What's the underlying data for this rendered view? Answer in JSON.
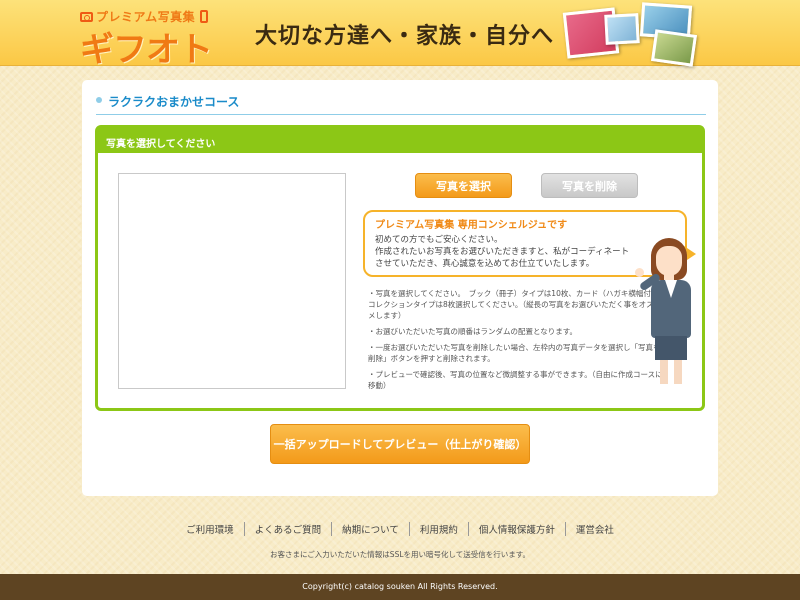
{
  "header": {
    "logo_sub": "プレミアム写真集",
    "logo_main": "ギフオト",
    "tagline": "大切な方達へ・家族・自分へ"
  },
  "section": {
    "title": "ラクラクおまかせコース"
  },
  "photo_box": {
    "header": "写真を選択してください",
    "select_button": "写真を選択",
    "delete_button": "写真を削除"
  },
  "bubble": {
    "title": "プレミアム写真集 専用コンシェルジュです",
    "lines": [
      "初めての方でもご安心ください。",
      "作成されたいお写真をお選びいただきますと、私がコーディネート",
      "させていただき、真心誠意を込めてお仕立ていたします。"
    ]
  },
  "notes": [
    "・写真を選択してください。　ブック（冊子）タイプは10枚、カード（ハガキ横幅付）コレクションタイプは8枚選択してください。（縦長の写真をお選びいただく事をオススメします）",
    "・お選びいただいた写真の順番はランダムの配置となります。",
    "・一度お選びいただいた写真を削除したい場合、左枠内の写真データを選択し「写真を削除」ボタンを押すと削除されます。",
    "・プレビューで確認後、写真の位置など微調整する事ができます。（自由に作成コースに移動）"
  ],
  "upload_button": "一括アップロードしてプレビュー（仕上がり確認）",
  "footer": {
    "links": [
      "ご利用環境",
      "よくあるご質問",
      "納期について",
      "利用規約",
      "個人情報保護方針",
      "運営会社"
    ],
    "ssl_note": "お客さまにご入力いただいた情報はSSLを用い暗号化して送受信を行います。",
    "copyright": "Copyright(c) catalog souken All Rights Reserved."
  },
  "colors": {
    "accent_orange": "#f39a1a",
    "accent_green": "#8cc716",
    "title_blue": "#1a8bc9",
    "footer_brown": "#5e4422"
  }
}
